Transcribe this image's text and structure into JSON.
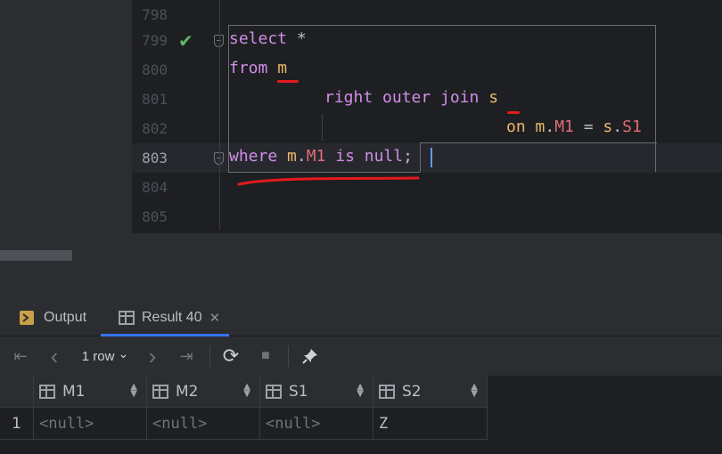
{
  "editor": {
    "lines": [
      {
        "num": "798"
      },
      {
        "num": "799"
      },
      {
        "num": "800"
      },
      {
        "num": "801"
      },
      {
        "num": "802"
      },
      {
        "num": "803"
      },
      {
        "num": "804"
      },
      {
        "num": "805"
      }
    ],
    "code": {
      "l799_kw": "select",
      "l799_rest": " *",
      "l800_kw": "from",
      "l800_alias": "m",
      "l801_kw": "right outer join",
      "l801_alias": "s",
      "l802_kw": "on",
      "l802_a": "m",
      "l802_dot1": ".",
      "l802_col1": "M1",
      "l802_eq": " = ",
      "l802_b": "s",
      "l802_dot2": ".",
      "l802_col2": "S1",
      "l803_kw1": "where",
      "l803_a": "m",
      "l803_dot": ".",
      "l803_col": "M1",
      "l803_kw2": "is null",
      "l803_semi": ";"
    }
  },
  "tool_window": {
    "tabs": [
      {
        "label": "Output",
        "icon": "output-icon"
      },
      {
        "label": "Result 40",
        "icon": "table-icon",
        "active": true
      }
    ],
    "toolbar": {
      "first": "⇤",
      "prev": "‹",
      "rows_label": "1 row",
      "next": "›",
      "last": "⇥",
      "chevron": "⌄",
      "refresh": "⟳",
      "stop": "■",
      "pin": "📌"
    }
  },
  "grid": {
    "columns": [
      "M1",
      "M2",
      "S1",
      "S2"
    ],
    "rows": [
      {
        "num": "1",
        "cells": [
          "<null>",
          "<null>",
          "<null>",
          "Z"
        ]
      }
    ]
  },
  "colors": {
    "accent": "#3574f0",
    "keyword": "#cf8ee6",
    "alias": "#e8b86b",
    "column": "#e06c75",
    "annotation": "#e51b1b"
  }
}
